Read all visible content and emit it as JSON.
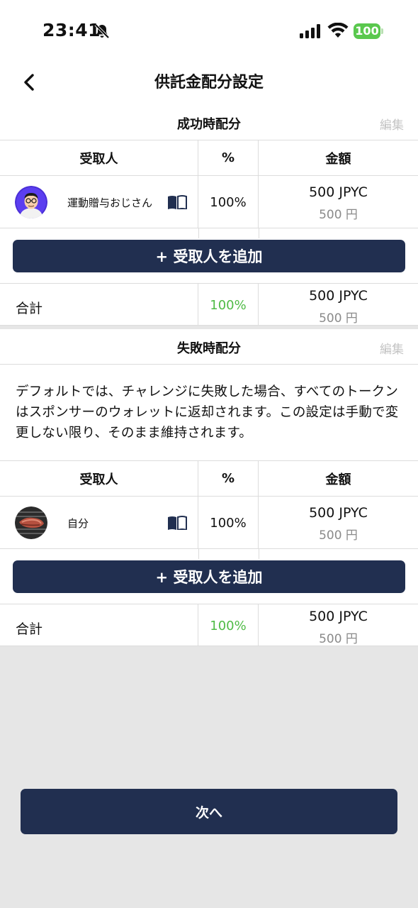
{
  "status_bar": {
    "time": "23:41",
    "battery": "100",
    "battery_color": "#5ac84e"
  },
  "header": {
    "title": "供託金配分設定",
    "back_icon": "chevron-left-icon"
  },
  "columns": {
    "recipient": "受取人",
    "percent": "%",
    "amount": "金額"
  },
  "success_section": {
    "title": "成功時配分",
    "edit_label": "編集",
    "recipients": [
      {
        "name": "運動贈与おじさん",
        "percent": "100%",
        "amount_jpyc": "500 JPYC",
        "amount_yen": "500 円",
        "avatar": "cartoon-man-avatar"
      }
    ],
    "add_label": "+ 受取人を追加",
    "total_label": "合計",
    "total_percent": "100%",
    "total_jpyc": "500 JPYC",
    "total_yen": "500 円"
  },
  "failure_section": {
    "title": "失敗時配分",
    "edit_label": "編集",
    "description": "デフォルトでは、チャレンジに失敗した場合、すべてのトークンはスポンサーのウォレットに返却されます。この設定は手動で変更しない限り、そのまま維持されます。",
    "recipients": [
      {
        "name": "自分",
        "percent": "100%",
        "amount_jpyc": "500 JPYC",
        "amount_yen": "500 円",
        "avatar": "grilled-meat-avatar"
      }
    ],
    "add_label": "+ 受取人を追加",
    "total_label": "合計",
    "total_percent": "100%",
    "total_jpyc": "500 JPYC",
    "total_yen": "500 円"
  },
  "footer": {
    "next_label": "次へ"
  },
  "colors": {
    "primary": "#212f50",
    "total_green": "#4fbb46",
    "muted": "#8a8a8a",
    "background": "#e6e6e6"
  }
}
